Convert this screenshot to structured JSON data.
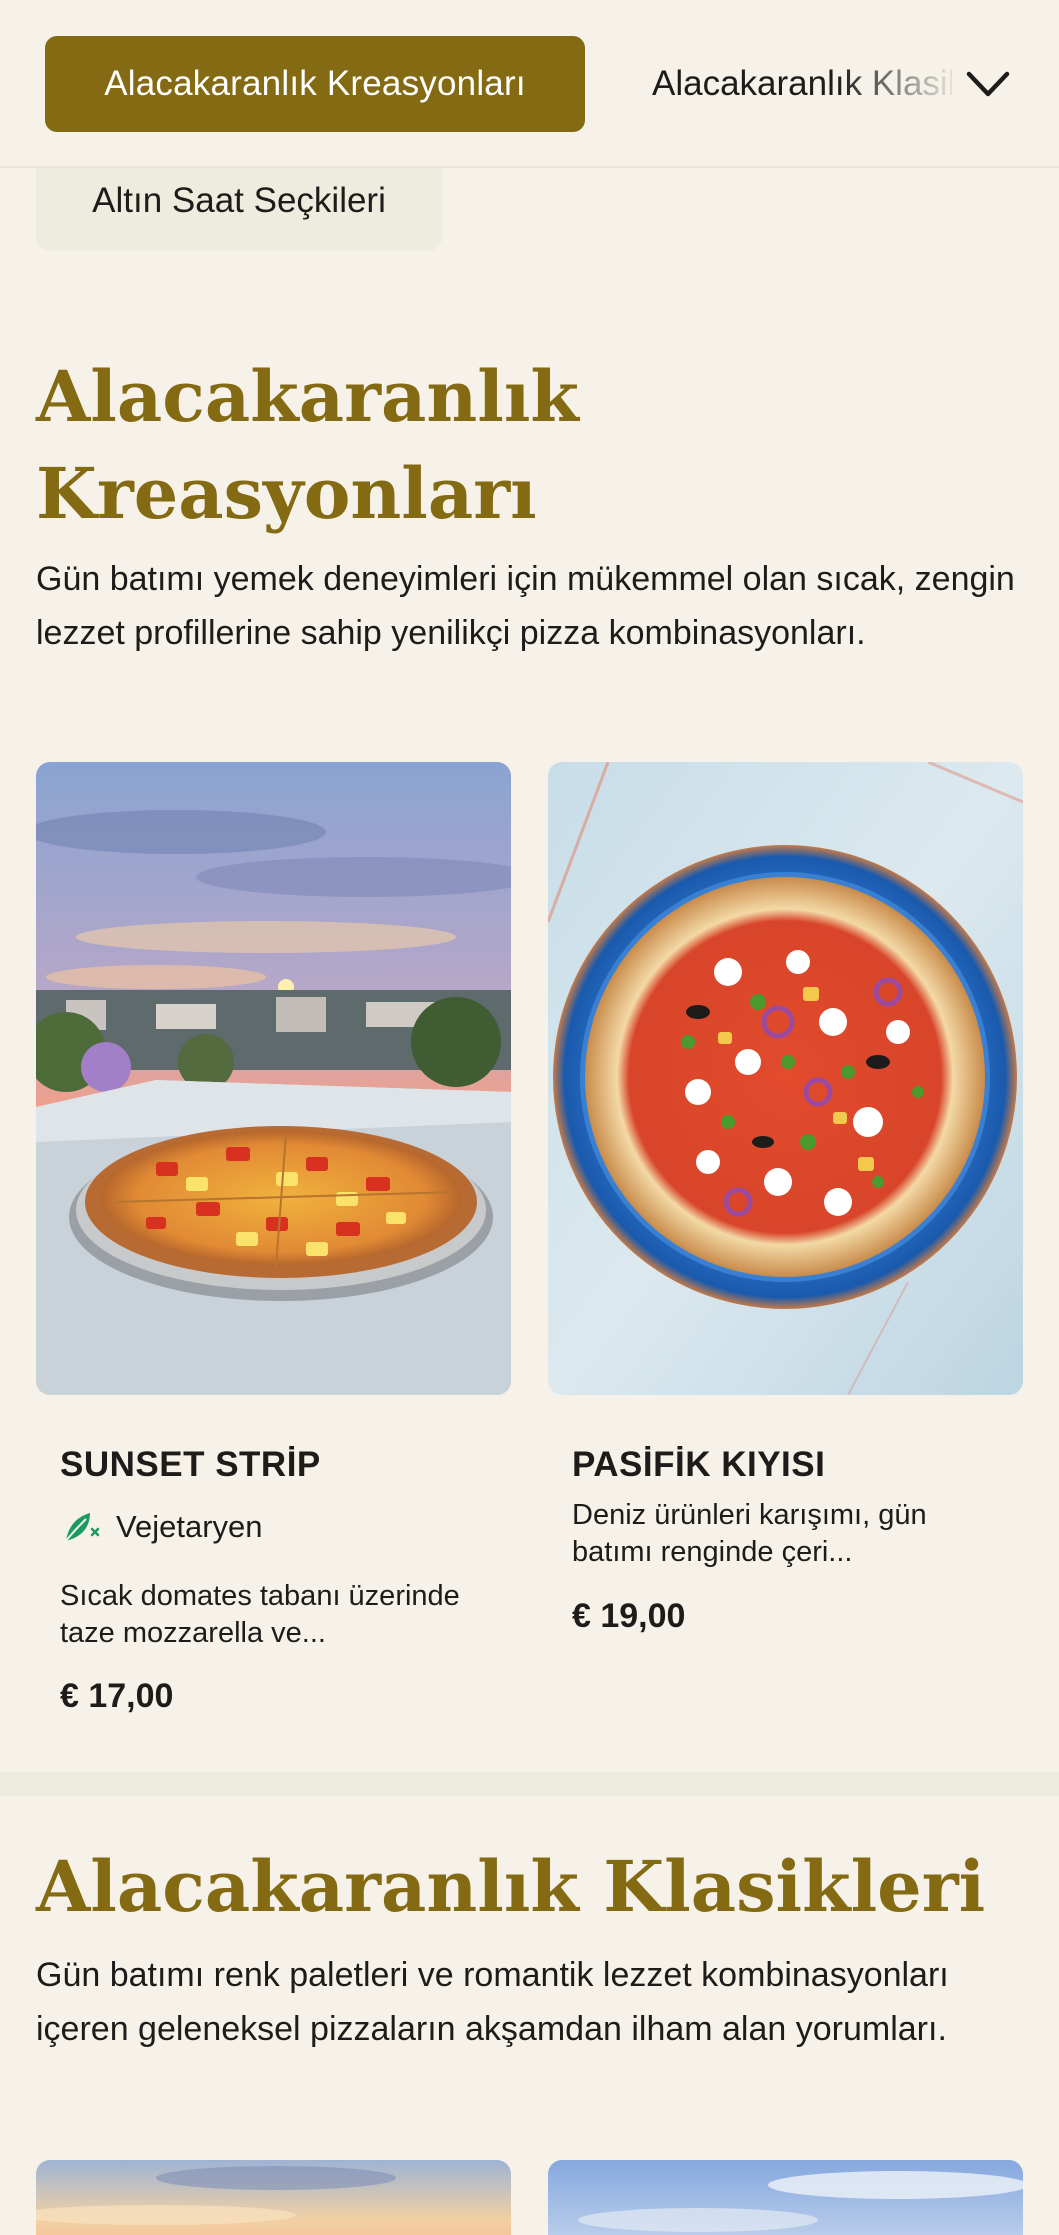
{
  "nav": {
    "active_category": "Alacakaranlık Kreasyonları",
    "next_category": "Alacakaranlık Klasikleri",
    "third_category": "Altın Saat Seçkileri",
    "dropdown_icon": "chevron-down-icon"
  },
  "sections": [
    {
      "title": "Alacakaranlık Kreasyonları",
      "description": "Gün batımı yemek deneyimleri için mükemmel olan sıcak, zengin lezzet profillerine sahip yenilikçi pizza kombinasyonları.",
      "items": [
        {
          "name": "SUNSET STRİP",
          "tag": "Vejetaryen",
          "tag_icon": "leaf-vegetarian-icon",
          "description": "Sıcak domates tabanı üzerinde taze mozzarella ve...",
          "price": "€ 17,00",
          "image": "pizza-sunset-terrace-photo"
        },
        {
          "name": "PASİFİK KIYISI",
          "description": "Deniz ürünleri karışımı, gün batımı renginde çeri...",
          "price": "€ 19,00",
          "image": "pizza-seafood-blue-plate-photo"
        }
      ]
    },
    {
      "title": "Alacakaranlık Klasikleri",
      "description": "Gün batımı renk paletleri ve romantik lezzet kombinasyonları içeren geleneksel pizzaların akşamdan ilham alan yorumları."
    }
  ],
  "colors": {
    "accent": "#846a12",
    "background": "#f6f2ea",
    "chip_background": "#eeebdf",
    "vegetarian_green": "#1c9a66"
  }
}
